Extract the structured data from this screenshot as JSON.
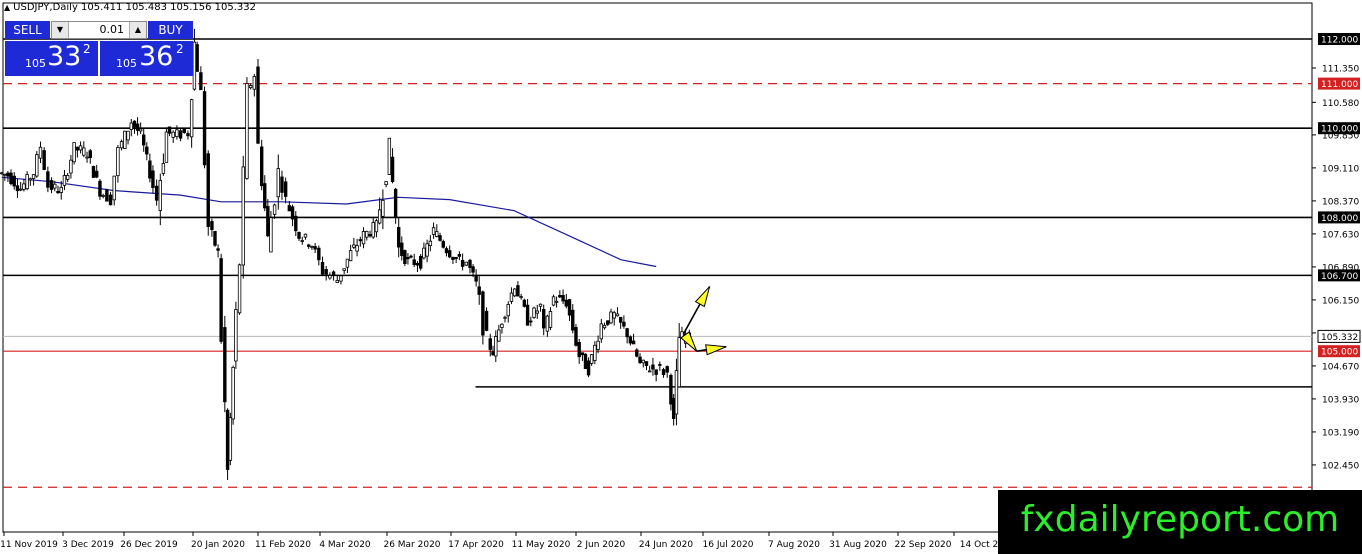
{
  "header": {
    "symbol_line": "USDJPY,Daily  105.411 105.483 105.156 105.332"
  },
  "trade_panel": {
    "sell_label": "SELL",
    "buy_label": "BUY",
    "lot": "0.01",
    "sell_prefix": "105",
    "sell_big": "33",
    "sell_sup": "2",
    "buy_prefix": "105",
    "buy_big": "36",
    "buy_sup": "2"
  },
  "watermark": "fxdailyreport.com",
  "colors": {
    "bull": "#000000",
    "bear": "#000000",
    "ma": "#1a1a9c",
    "support": "#000000",
    "dashed": "#d32020",
    "arrow": "#ffff22",
    "panel": "#1d2ad6"
  },
  "chart_data": {
    "type": "candlestick",
    "symbol": "USDJPY",
    "timeframe": "Daily",
    "ohlc_last": {
      "open": 105.411,
      "high": 105.483,
      "low": 105.156,
      "close": 105.332
    },
    "y_ticks": [
      "111.350",
      "110.580",
      "109.850",
      "109.110",
      "108.370",
      "107.630",
      "106.890",
      "106.150",
      "105.410",
      "104.670",
      "103.930",
      "103.190",
      "102.450"
    ],
    "x_ticks": [
      "11 Nov 2019",
      "3 Dec 2019",
      "26 Dec 2019",
      "20 Jan 2020",
      "11 Feb 2020",
      "4 Mar 2020",
      "26 Mar 2020",
      "17 Apr 2020",
      "11 May 2020",
      "2 Jun 2020",
      "24 Jun 2020",
      "16 Jul 2020",
      "7 Aug 2020",
      "31 Aug 2020",
      "22 Sep 2020",
      "14 Oct 2"
    ],
    "ylim": [
      101.7,
      112.4
    ],
    "current_price": "105.332",
    "levels": [
      {
        "price": 112.0,
        "label": "112.000",
        "style": "solid-black"
      },
      {
        "price": 111.0,
        "label": "111.000",
        "style": "dashed-red"
      },
      {
        "price": 110.0,
        "label": "110.000",
        "style": "solid-black"
      },
      {
        "price": 108.0,
        "label": "108.000",
        "style": "solid-black"
      },
      {
        "price": 106.7,
        "label": "106.700",
        "style": "solid-black"
      },
      {
        "price": 105.0,
        "label": "105.000",
        "style": "solid-red"
      },
      {
        "price": 104.2,
        "label": "",
        "style": "solid-black-partial",
        "from": "20 Jul 2020"
      },
      {
        "price": 101.95,
        "label": "",
        "style": "dashed-red"
      }
    ],
    "series": [
      {
        "name": "",
        "kind": "ohlc",
        "points": [
          {
            "date": "2019-11-06",
            "close": 109.0
          },
          {
            "date": "2019-11-11",
            "close": 108.95
          },
          {
            "date": "2019-11-18",
            "close": 108.65
          },
          {
            "date": "2019-11-25",
            "close": 109.0
          },
          {
            "date": "2019-11-29",
            "close": 109.6
          },
          {
            "date": "2019-12-03",
            "close": 108.7
          },
          {
            "date": "2019-12-10",
            "close": 108.6
          },
          {
            "date": "2019-12-17",
            "close": 109.55
          },
          {
            "date": "2019-12-24",
            "close": 109.45
          },
          {
            "date": "2019-12-31",
            "close": 108.6
          },
          {
            "date": "2020-01-06",
            "close": 108.4
          },
          {
            "date": "2020-01-10",
            "close": 109.5
          },
          {
            "date": "2020-01-17",
            "close": 110.15
          },
          {
            "date": "2020-01-22",
            "close": 109.85
          },
          {
            "date": "2020-01-27",
            "close": 109.0
          },
          {
            "date": "2020-01-31",
            "close": 108.4
          },
          {
            "date": "2020-02-05",
            "close": 109.9
          },
          {
            "date": "2020-02-11",
            "close": 109.85
          },
          {
            "date": "2020-02-17",
            "close": 109.9
          },
          {
            "date": "2020-02-20",
            "close": 111.9
          },
          {
            "date": "2020-02-24",
            "close": 110.8
          },
          {
            "date": "2020-02-28",
            "close": 107.8
          },
          {
            "date": "2020-03-04",
            "close": 107.2
          },
          {
            "date": "2020-03-06",
            "close": 105.3
          },
          {
            "date": "2020-03-09",
            "close": 102.3
          },
          {
            "date": "2020-03-12",
            "close": 104.6
          },
          {
            "date": "2020-03-16",
            "close": 107.0
          },
          {
            "date": "2020-03-20",
            "close": 110.8
          },
          {
            "date": "2020-03-24",
            "close": 111.2
          },
          {
            "date": "2020-03-26",
            "close": 109.6
          },
          {
            "date": "2020-03-31",
            "close": 107.5
          },
          {
            "date": "2020-04-06",
            "close": 109.0
          },
          {
            "date": "2020-04-10",
            "close": 108.4
          },
          {
            "date": "2020-04-17",
            "close": 107.6
          },
          {
            "date": "2020-04-24",
            "close": 107.4
          },
          {
            "date": "2020-04-30",
            "close": 106.8
          },
          {
            "date": "2020-05-08",
            "close": 106.6
          },
          {
            "date": "2020-05-15",
            "close": 107.2
          },
          {
            "date": "2020-05-22",
            "close": 107.6
          },
          {
            "date": "2020-05-29",
            "close": 107.8
          },
          {
            "date": "2020-06-05",
            "close": 109.5
          },
          {
            "date": "2020-06-10",
            "close": 107.3
          },
          {
            "date": "2020-06-15",
            "close": 107.0
          },
          {
            "date": "2020-06-22",
            "close": 107.0
          },
          {
            "date": "2020-06-29",
            "close": 107.7
          },
          {
            "date": "2020-07-06",
            "close": 107.3
          },
          {
            "date": "2020-07-13",
            "close": 107.0
          },
          {
            "date": "2020-07-17",
            "close": 107.0
          },
          {
            "date": "2020-07-22",
            "close": 106.5
          },
          {
            "date": "2020-07-28",
            "close": 105.2
          },
          {
            "date": "2020-07-31",
            "close": 105.0
          },
          {
            "date": "2020-08-05",
            "close": 105.7
          },
          {
            "date": "2020-08-12",
            "close": 106.5
          },
          {
            "date": "2020-08-19",
            "close": 105.7
          },
          {
            "date": "2020-08-26",
            "close": 106.0
          },
          {
            "date": "2020-08-28",
            "close": 105.4
          },
          {
            "date": "2020-09-02",
            "close": 106.2
          },
          {
            "date": "2020-09-09",
            "close": 106.1
          },
          {
            "date": "2020-09-16",
            "close": 104.9
          },
          {
            "date": "2020-09-21",
            "close": 104.6
          },
          {
            "date": "2020-09-28",
            "close": 105.6
          },
          {
            "date": "2020-10-05",
            "close": 105.8
          },
          {
            "date": "2020-10-12",
            "close": 105.4
          },
          {
            "date": "2020-10-19",
            "close": 104.7
          },
          {
            "date": "2020-10-26",
            "close": 104.6
          },
          {
            "date": "2020-10-30",
            "close": 104.6
          },
          {
            "date": "2020-11-03",
            "close": 104.5
          },
          {
            "date": "2020-11-06",
            "close": 103.4
          },
          {
            "date": "2020-11-09",
            "close": 105.3
          },
          {
            "date": "2020-11-13",
            "close": 105.332
          }
        ]
      },
      {
        "name": "",
        "kind": "moving-average",
        "points": [
          {
            "date": "2019-11-06",
            "value": 108.9
          },
          {
            "date": "2019-12-03",
            "value": 108.8
          },
          {
            "date": "2020-01-06",
            "value": 108.6
          },
          {
            "date": "2020-02-11",
            "value": 108.5
          },
          {
            "date": "2020-03-04",
            "value": 108.35
          },
          {
            "date": "2020-04-06",
            "value": 108.35
          },
          {
            "date": "2020-05-11",
            "value": 108.3
          },
          {
            "date": "2020-06-08",
            "value": 108.45
          },
          {
            "date": "2020-07-06",
            "value": 108.4
          },
          {
            "date": "2020-08-10",
            "value": 108.15
          },
          {
            "date": "2020-09-08",
            "value": 107.6
          },
          {
            "date": "2020-10-07",
            "value": 107.05
          },
          {
            "date": "2020-10-26",
            "value": 106.9
          }
        ]
      }
    ],
    "annotations": [
      {
        "type": "arrow",
        "from": {
          "date": "2020-11-10",
          "price": 105.4
        },
        "to": {
          "date": "2020-11-24",
          "price": 106.45
        }
      },
      {
        "type": "arrow",
        "from": {
          "date": "2020-11-10",
          "price": 105.4
        },
        "to": {
          "date": "2020-11-17",
          "price": 105.0
        }
      },
      {
        "type": "arrow",
        "from": {
          "date": "2020-11-17",
          "price": 105.0
        },
        "to": {
          "date": "2020-12-03",
          "price": 105.1
        }
      }
    ]
  }
}
